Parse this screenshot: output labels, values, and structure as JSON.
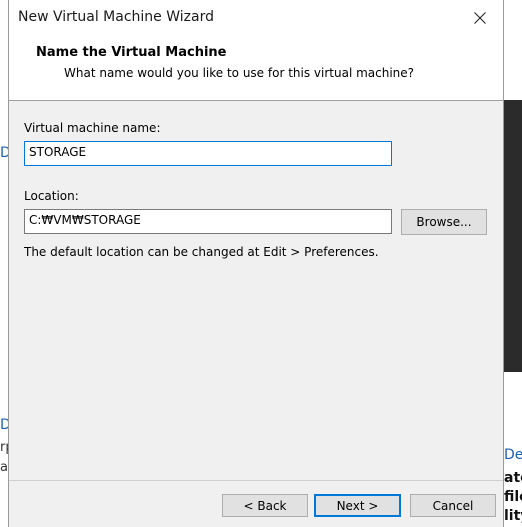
{
  "window": {
    "title": "New Virtual Machine Wizard"
  },
  "header": {
    "title": "Name the Virtual Machine",
    "subtitle": "What name would you like to use for this virtual machine?"
  },
  "form": {
    "name_label": "Virtual machine name:",
    "name_value": "STORAGE",
    "location_label": "Location:",
    "location_value": "C:₩VM₩STORAGE",
    "browse_label": "Browse...",
    "hint": "The default location can be changed at Edit > Preferences."
  },
  "footer": {
    "back_label": "< Back",
    "next_label": "Next >",
    "cancel_label": "Cancel"
  },
  "background": {
    "left_fragments": [
      "De",
      "De",
      "rp",
      "a"
    ],
    "right_fragments": [
      "Def",
      "ato",
      "file",
      "lity"
    ]
  }
}
